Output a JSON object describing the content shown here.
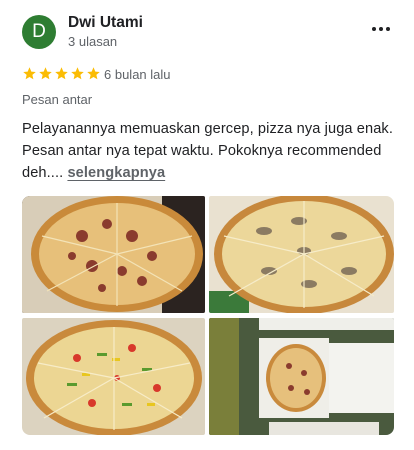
{
  "reviewer": {
    "initial": "D",
    "name": "Dwi Utami",
    "review_count": "3 ulasan",
    "avatar_color": "#2e7d32"
  },
  "rating": {
    "stars": 5,
    "max": 5,
    "color": "#fbbc04"
  },
  "time_ago": "6 bulan lalu",
  "service_type": "Pesan antar",
  "review": {
    "text": "Pelayanannya memuaskan gercep, pizza nya juga enak. Pesan antar nya tepat waktu. Pokoknya recommended deh....",
    "more_label": "selengkapnya"
  },
  "photos": [
    {
      "icon": "pizza-photo-meat"
    },
    {
      "icon": "pizza-photo-mushroom"
    },
    {
      "icon": "pizza-photo-vegetable"
    },
    {
      "icon": "pizza-boxes-photo"
    }
  ]
}
